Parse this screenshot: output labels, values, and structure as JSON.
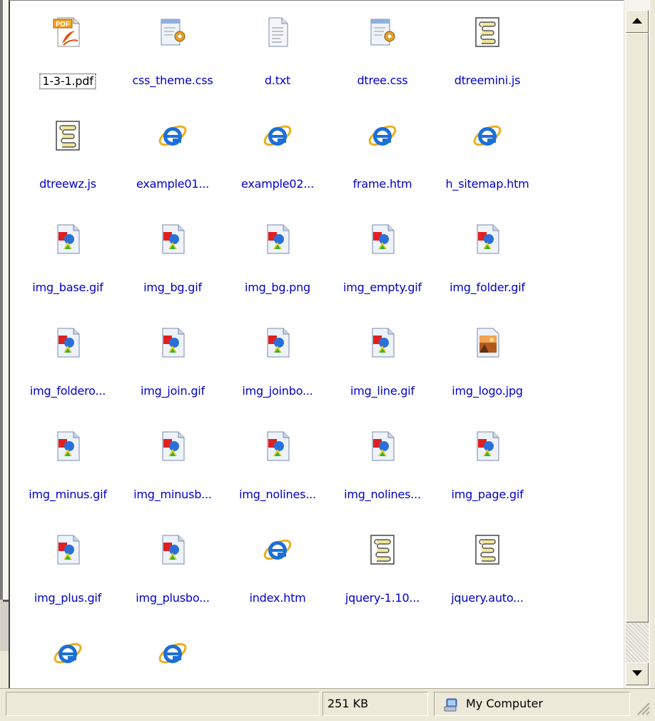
{
  "files": [
    {
      "name": "1-3-1.pdf",
      "icon": "pdf-icon",
      "selected": true
    },
    {
      "name": "css_theme.css",
      "icon": "css-icon"
    },
    {
      "name": "d.txt",
      "icon": "txt-icon"
    },
    {
      "name": "dtree.css",
      "icon": "css-icon"
    },
    {
      "name": "dtreemini.js",
      "icon": "script-icon"
    },
    {
      "name": "dtreewz.js",
      "icon": "script-icon"
    },
    {
      "name": "example01...",
      "icon": "ie-icon"
    },
    {
      "name": "example02...",
      "icon": "ie-icon"
    },
    {
      "name": "frame.htm",
      "icon": "ie-icon"
    },
    {
      "name": "h_sitemap.htm",
      "icon": "ie-icon"
    },
    {
      "name": "img_base.gif",
      "icon": "image-icon"
    },
    {
      "name": "img_bg.gif",
      "icon": "image-icon"
    },
    {
      "name": "img_bg.png",
      "icon": "image-icon"
    },
    {
      "name": "img_empty.gif",
      "icon": "image-icon"
    },
    {
      "name": "img_folder.gif",
      "icon": "image-icon"
    },
    {
      "name": "img_foldero...",
      "icon": "image-icon"
    },
    {
      "name": "img_join.gif",
      "icon": "image-icon"
    },
    {
      "name": "img_joinbo...",
      "icon": "image-icon"
    },
    {
      "name": "img_line.gif",
      "icon": "image-icon"
    },
    {
      "name": "img_logo.jpg",
      "icon": "photo-icon"
    },
    {
      "name": "img_minus.gif",
      "icon": "image-icon"
    },
    {
      "name": "img_minusb...",
      "icon": "image-icon"
    },
    {
      "name": "img_nolines...",
      "icon": "image-icon"
    },
    {
      "name": "img_nolines...",
      "icon": "image-icon"
    },
    {
      "name": "img_page.gif",
      "icon": "image-icon"
    },
    {
      "name": "img_plus.gif",
      "icon": "image-icon"
    },
    {
      "name": "img_plusbo...",
      "icon": "image-icon"
    },
    {
      "name": "index.htm",
      "icon": "ie-icon"
    },
    {
      "name": "jquery-1.10...",
      "icon": "script-icon"
    },
    {
      "name": "jquery.auto...",
      "icon": "script-icon"
    },
    {
      "name": "",
      "icon": "ie-icon"
    },
    {
      "name": "",
      "icon": "ie-icon"
    }
  ],
  "statusbar": {
    "main": "",
    "size": "251 KB",
    "zone": "My Computer"
  }
}
